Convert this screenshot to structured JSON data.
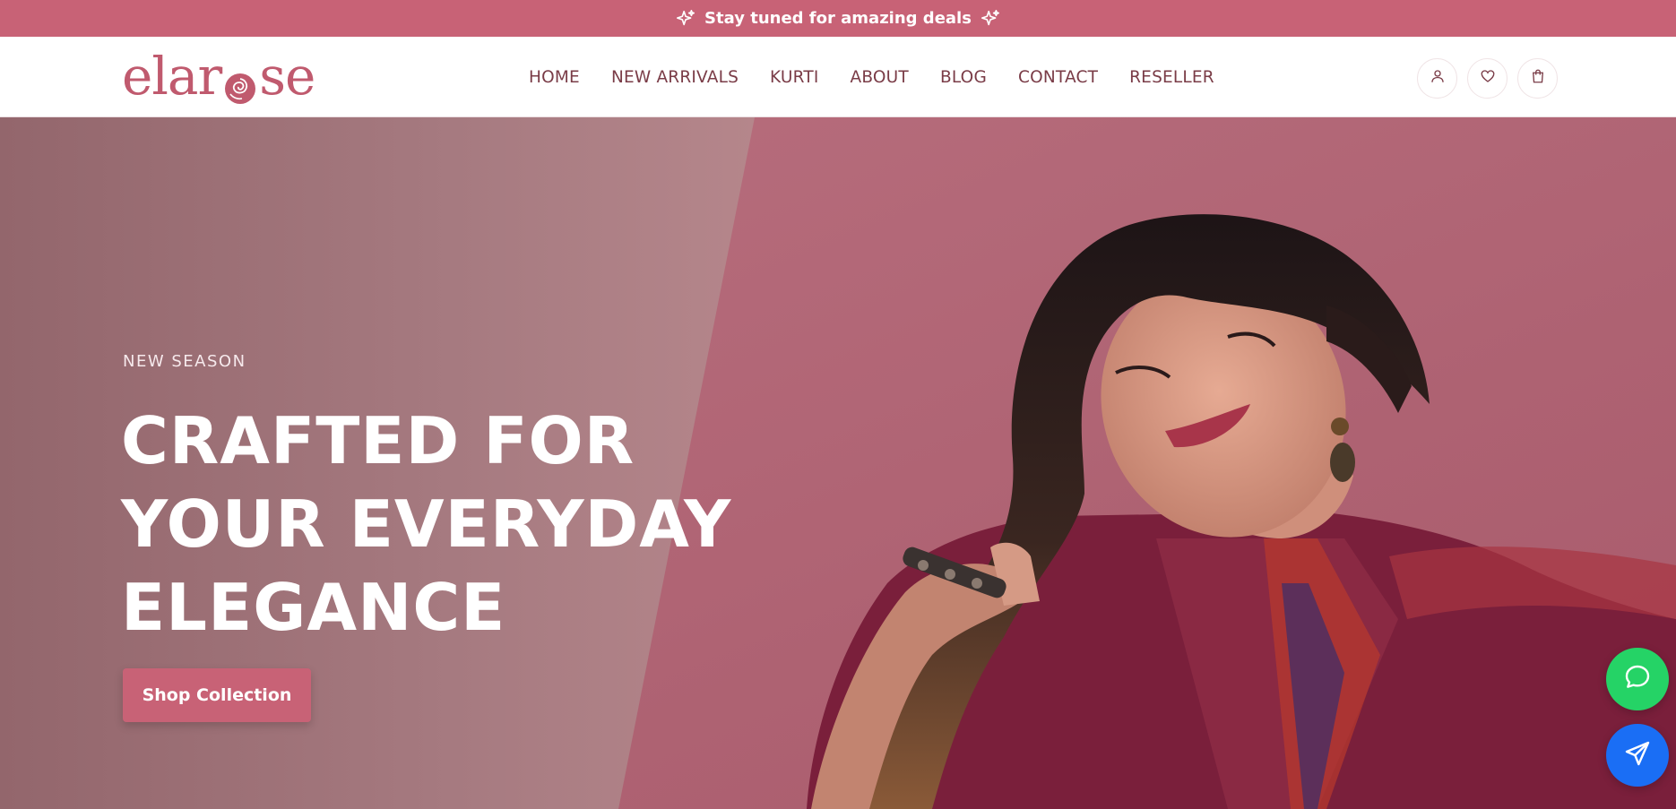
{
  "announcement": {
    "text": "Stay tuned for amazing deals",
    "left_icon": "sparkle-icon",
    "right_icon": "sparkle-icon"
  },
  "header": {
    "logo_text": "elarose",
    "nav": [
      {
        "label": "HOME"
      },
      {
        "label": "NEW ARRIVALS"
      },
      {
        "label": "KURTI"
      },
      {
        "label": "ABOUT"
      },
      {
        "label": "BLOG"
      },
      {
        "label": "CONTACT"
      },
      {
        "label": "RESELLER"
      }
    ],
    "icons": [
      "user-icon",
      "heart-icon",
      "shopping-bag-icon"
    ]
  },
  "hero": {
    "kicker": "NEW SEASON",
    "title_lines": [
      "CRAFTED FOR",
      "YOUR EVERYDAY",
      "ELEGANCE"
    ],
    "cta_label": "Shop Collection"
  },
  "floating": {
    "chat_icon": "chat-bubble-icon",
    "send_icon": "paper-plane-icon"
  },
  "colors": {
    "brand": "#c86276",
    "nav_text": "#7a3c47",
    "chat_green": "#25d366",
    "send_blue": "#1a6ef5"
  }
}
